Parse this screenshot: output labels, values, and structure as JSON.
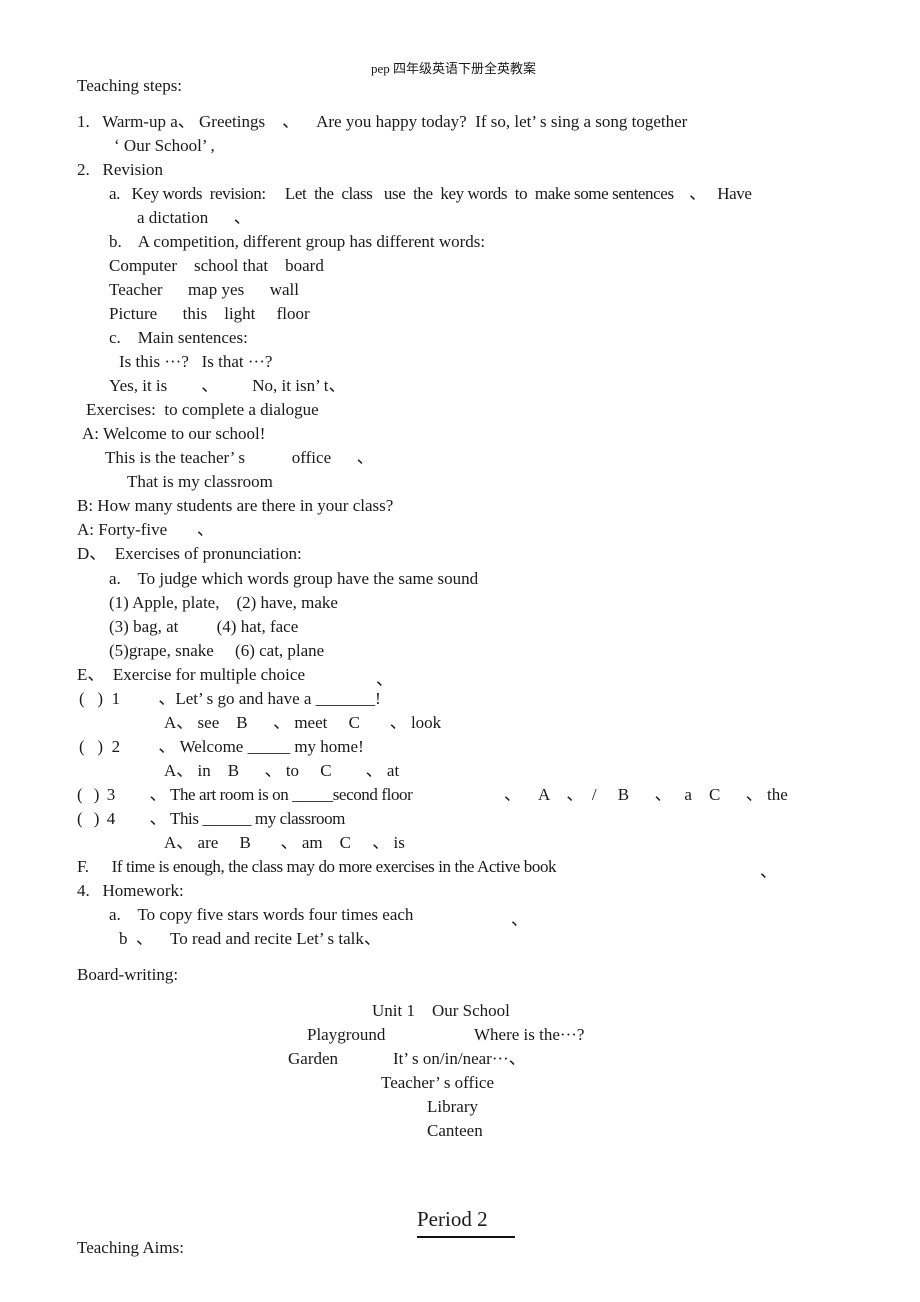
{
  "header": "pep 四年级英语下册全英教案",
  "teaching_steps_title": "Teaching steps:",
  "steps": {
    "s1a": "1.   Warm-up a、 Greetings    、    Are you happy today?  If so, let’ s sing a song together",
    "s1b": "‘ Our School’ ,",
    "s2": "2.   Revision",
    "s2a_1": "a.   Key words  revision:     Let  the  class   use  the  key words  to  make some sentences    、   Have",
    "s2a_2": "a dictation      、",
    "s2b": "b.    A competition, different group has different words:",
    "words_row1": "Computer    school that    board",
    "words_row2": "Teacher      map yes      wall",
    "words_row3": "Picture      this    light     floor",
    "s2c": "c.    Main sentences:",
    "sent1": "Is this ···?   Is that ···?",
    "sent2": "Yes, it is        、        No, it isn’ t、",
    "exercises": "Exercises:  to complete a dialogue",
    "dlg1": "A: Welcome to our school!",
    "dlg2": "This is the teacher’ s           office      、",
    "dlg3": "That is my classroom",
    "dlg4": "B: How many students are there in your class?",
    "dlg5": "A: Forty-five       、",
    "sD": "D、  Exercises of pronunciation:",
    "sDa": "a.    To judge which words group have the same sound",
    "pr1": "(1) Apple, plate,    (2) have, make",
    "pr2": "(3) bag, at         (4) hat, face",
    "pr3": "(5)grape, snake     (6) cat, plane",
    "sE": "E、  Exercise for multiple choice",
    "sE_mark": "、",
    "q1": "(   )  1         、Let’ s go and have a _______!",
    "q1_opts": "A、 see    B      、 meet     C       、 look",
    "q2": "(   )  2         、 Welcome _____ my home!",
    "q2_opts": "A、 in    B      、 to     C        、 at",
    "q3": "(   )  3         、 The art room is on _____second floor",
    "q3_opts": "、    A    、  /     B      、   a    C      、 the",
    "q4": "(   )  4         、 This ______ my classroom",
    "q4_opts": "A、 are     B       、 am    C     、 is",
    "sF": "F.      If time is enough, the class may do more exercises in the Active book",
    "sF_mark": "、",
    "s4": "4.   Homework:",
    "s4a": "a.    To copy five stars words four times each",
    "s4a_mark": "、",
    "s4b": "b  、    To read and recite Let’ s talk、"
  },
  "board": {
    "title": "Board-writing:",
    "unit": "Unit 1    Our School",
    "playground": "Playground",
    "where": "Where is the···?",
    "garden": "Garden",
    "its": "It’ s on/in/near···、",
    "office": "Teacher’ s office",
    "library": "Library",
    "canteen": "Canteen"
  },
  "period": "Period 2",
  "teaching_aims_title": "Teaching Aims:"
}
